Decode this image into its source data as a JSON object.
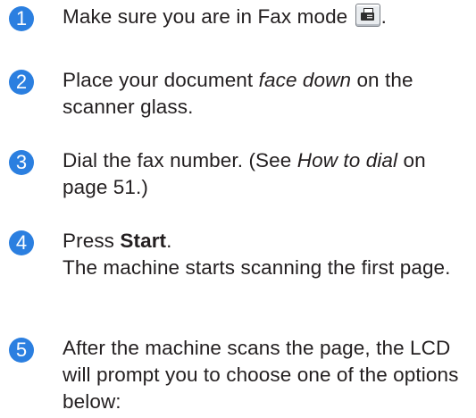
{
  "accent_color": "#2b7fe0",
  "steps": [
    {
      "number": "1",
      "text_before_icon": "Make sure you are in Fax mode ",
      "icon": "fax-mode-icon",
      "text_after_icon": "."
    },
    {
      "number": "2",
      "text_before": "Place your document ",
      "text_italic": "face down",
      "text_after": " on the scanner glass."
    },
    {
      "number": "3",
      "text_before": "Dial the fax number. (See ",
      "text_italic": "How to dial",
      "text_after": " on page 51.)"
    },
    {
      "number": "4",
      "text_before": "Press ",
      "text_bold": "Start",
      "text_after": ".",
      "text_second_line": "The machine starts scanning the first page."
    },
    {
      "number": "5",
      "text": "After the machine scans the page, the LCD will prompt you to choose one of the options below:"
    }
  ]
}
